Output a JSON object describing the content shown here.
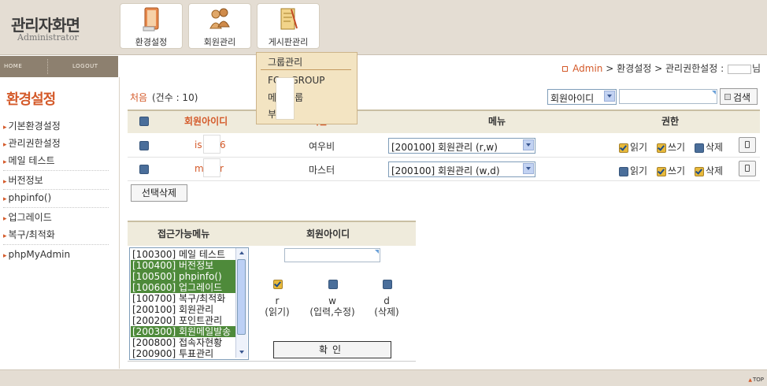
{
  "header": {
    "title": "관리자화면",
    "subtitle": "Administrator",
    "buttons": [
      {
        "label": "환경설정",
        "icon": "gear-book-icon"
      },
      {
        "label": "회원관리",
        "icon": "members-icon"
      },
      {
        "label": "게시판관리",
        "icon": "board-icon"
      }
    ]
  },
  "nav": {
    "home": "HOME",
    "logout": "LOGOUT"
  },
  "sidebar": {
    "title": "환경설정",
    "items": [
      {
        "label": "기본환경설정"
      },
      {
        "label": "관리권한설정"
      },
      {
        "label": "메일 테스트"
      },
      {
        "label": "버전정보"
      },
      {
        "label": "phpinfo()"
      },
      {
        "label": "업그레이드"
      },
      {
        "label": "복구/최적화"
      },
      {
        "label": "phpMyAdmin"
      }
    ]
  },
  "breadcrumb": {
    "admin": "Admin",
    "sep": ">",
    "level1": "환경설정",
    "level2": "관리권한설정 :",
    "suffix": "님"
  },
  "list": {
    "first": "처음",
    "count": "(건수 : 10)",
    "search_select": "회원아이디",
    "search_button": "검색",
    "headers": {
      "userid": "회원아이디",
      "name": "이름",
      "menu": "메뉴",
      "perm": "권한"
    },
    "rows": [
      {
        "userid_prefix": "is",
        "userid_suffix": "6",
        "name": "여우비",
        "menu": "[200100] 회원관리 (r,w)",
        "perms": [
          {
            "label": "읽기",
            "on": true
          },
          {
            "label": "쓰기",
            "on": true
          },
          {
            "label": "삭제",
            "on": false
          }
        ]
      },
      {
        "userid_prefix": "m",
        "userid_suffix": "r",
        "name": "마스터",
        "menu": "[200100] 회원관리 (w,d)",
        "perms": [
          {
            "label": "읽기",
            "on": false
          },
          {
            "label": "쓰기",
            "on": true
          },
          {
            "label": "삭제",
            "on": true
          }
        ]
      }
    ],
    "delete_selected": "선택삭제"
  },
  "panel": {
    "header_menu": "접근가능메뉴",
    "header_member": "회원아이디",
    "menu_options": [
      {
        "label": "[100300] 메일 테스트",
        "selected": false
      },
      {
        "label": "[100400] 버전정보",
        "selected": true
      },
      {
        "label": "[100500] phpinfo()",
        "selected": true
      },
      {
        "label": "[100600] 업그레이드",
        "selected": true
      },
      {
        "label": "[100700] 복구/최적화",
        "selected": false
      },
      {
        "label": "[200100] 회원관리",
        "selected": false
      },
      {
        "label": "[200200] 포인트관리",
        "selected": false
      },
      {
        "label": "[200300] 회원메일발송",
        "selected": true
      },
      {
        "label": "[200800] 접속자현황",
        "selected": false
      },
      {
        "label": "[200900] 투표관리",
        "selected": false
      }
    ],
    "perms": [
      {
        "code": "r",
        "desc": "(읽기)",
        "on": true
      },
      {
        "code": "w",
        "desc": "(입력,수정)",
        "on": false
      },
      {
        "code": "d",
        "desc": "(삭제)",
        "on": false
      }
    ],
    "confirm": "확인"
  },
  "dropdown": {
    "items": [
      "그룹관리",
      "FORM GROUP",
      "메뉴그룹",
      "부고"
    ],
    "visible_fragments": {
      "form_left": "FO",
      "form_right": "GROUP",
      "menu_left": "메",
      "menu_right": "그룹",
      "obit_left": "부",
      "obit_right": "고"
    }
  },
  "footer": {
    "top": "TOP"
  },
  "colors": {
    "accent": "#d45a2a",
    "header_bg": "#e4ddd3",
    "nav_bg": "#8d806f",
    "selected_option": "#4e8a3a",
    "dropdown_bg": "#f3e4c2"
  }
}
